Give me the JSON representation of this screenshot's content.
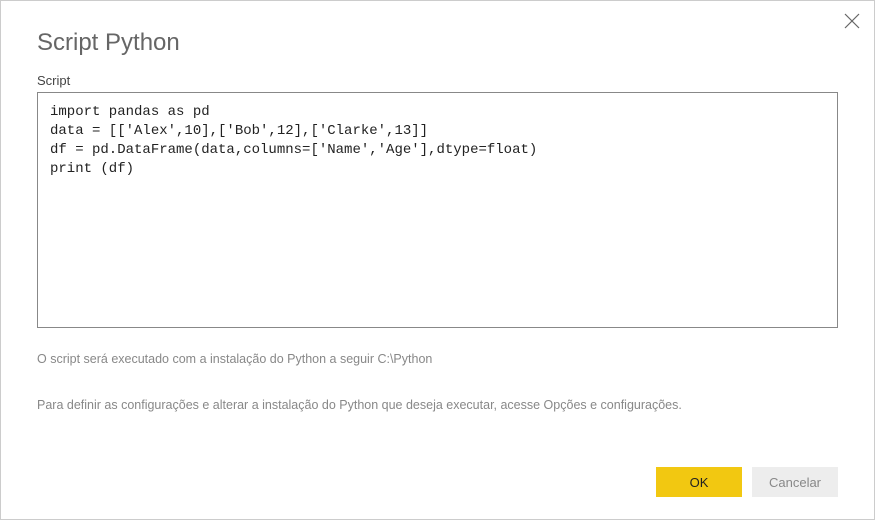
{
  "dialog": {
    "title": "Script Python",
    "script_label": "Script",
    "script_value": "import pandas as pd\ndata = [['Alex',10],['Bob',12],['Clarke',13]]\ndf = pd.DataFrame(data,columns=['Name','Age'],dtype=float)\nprint (df)",
    "info_path": "O script será executado com a instalação do Python a seguir C:\\Python",
    "info_settings": "Para definir as configurações e alterar a instalação do Python que deseja executar, acesse Opções e configurações.",
    "ok_label": "OK",
    "cancel_label": "Cancelar"
  },
  "colors": {
    "primary_button": "#F2C811",
    "secondary_button": "#ededed"
  }
}
